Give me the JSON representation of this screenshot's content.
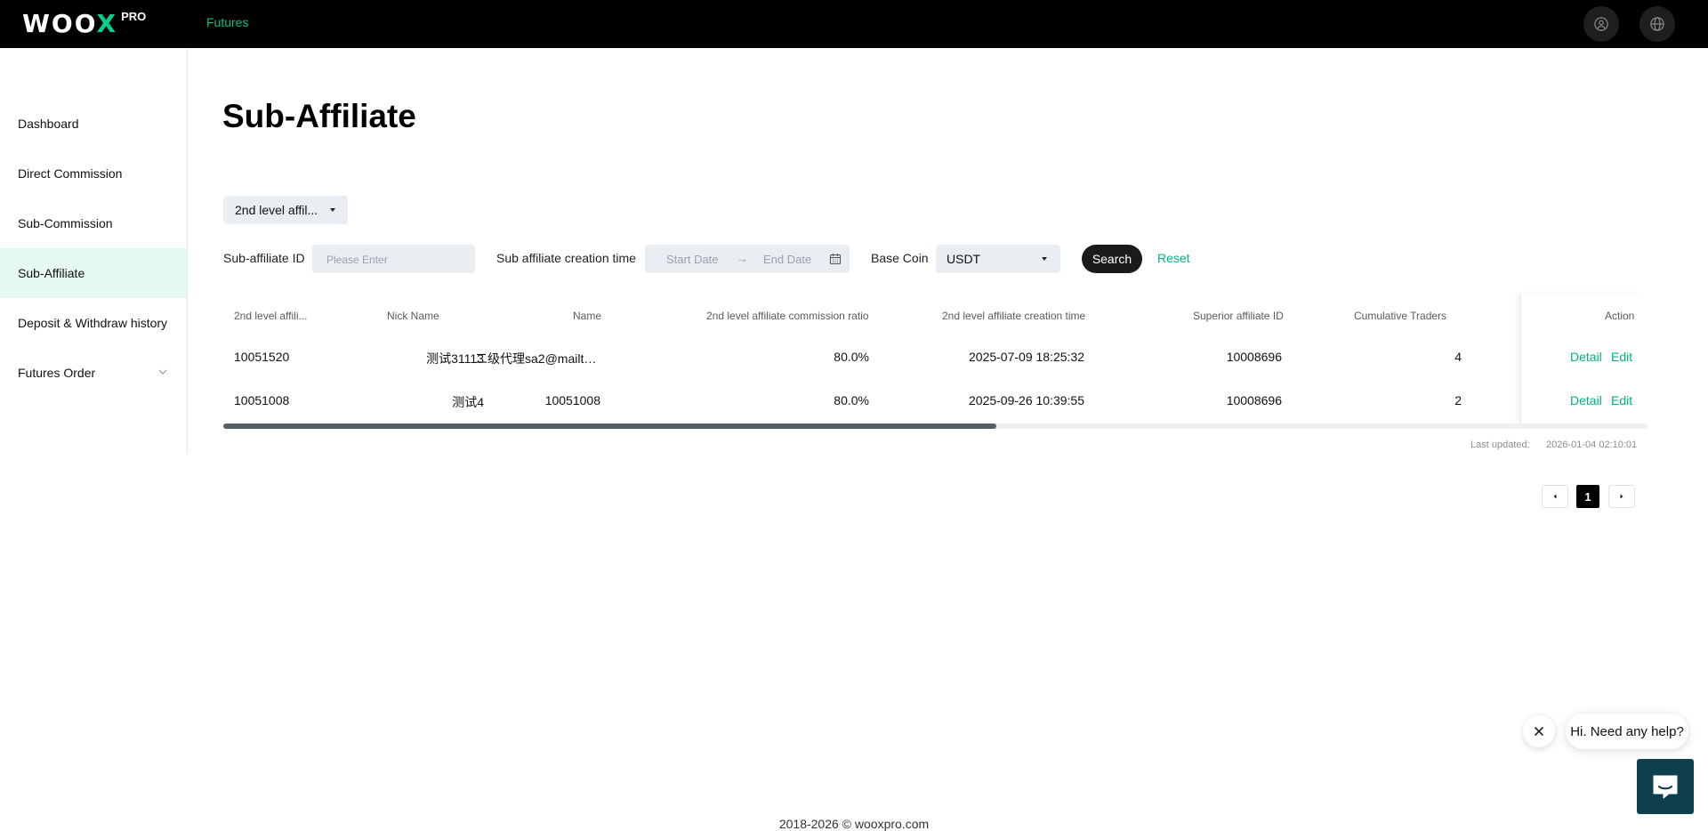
{
  "brand": {
    "logo_main": "WOOX",
    "logo_suffix": "PRO"
  },
  "header": {
    "nav_futures": "Futures",
    "profile_icon": "user-circle-icon",
    "language_icon": "globe-icon"
  },
  "sidebar": {
    "items": [
      {
        "label": "Dashboard"
      },
      {
        "label": "Direct Commission"
      },
      {
        "label": "Sub-Commission"
      },
      {
        "label": "Sub-Affiliate",
        "active": true
      },
      {
        "label": "Deposit & Withdraw history"
      },
      {
        "label": "Futures Order",
        "expandable": true
      }
    ]
  },
  "page": {
    "title": "Sub-Affiliate"
  },
  "level_select": {
    "value": "2nd level affil..."
  },
  "filters": {
    "sub_affiliate_id_label": "Sub-affiliate ID",
    "sub_affiliate_id_placeholder": "Please Enter",
    "creation_time_label": "Sub affiliate creation time",
    "start_date_placeholder": "Start Date",
    "arrow": "→",
    "end_date_placeholder": "End Date",
    "base_coin_label": "Base Coin",
    "base_coin_value": "USDT",
    "search_label": "Search",
    "reset_label": "Reset"
  },
  "table": {
    "headers": {
      "id": "2nd level affili...",
      "nick": "Nick Name",
      "name": "Name",
      "ratio": "2nd level affiliate commission ratio",
      "created": "2nd level affiliate creation time",
      "superior": "Superior affiliate ID",
      "traders": "Cumulative Traders",
      "action": "Action"
    },
    "rows": [
      {
        "id": "10051520",
        "nick": "测试31113",
        "name": "二级代理sa2@mailt…",
        "ratio": "80.0%",
        "created": "2025-07-09 18:25:32",
        "superior": "10008696",
        "traders": "4",
        "detail": "Detail",
        "edit": "Edit"
      },
      {
        "id": "10051008",
        "nick": "测试4",
        "name": "10051008",
        "ratio": "80.0%",
        "created": "2025-09-26 10:39:55",
        "superior": "10008696",
        "traders": "2",
        "detail": "Detail",
        "edit": "Edit"
      }
    ]
  },
  "last_updated": {
    "label": "Last updated:",
    "value": "2026-01-04 02:10:01"
  },
  "pagination": {
    "current": "1"
  },
  "chat": {
    "greeting": "Hi. Need any help?"
  },
  "footer": {
    "text": "2018-2026 © wooxpro.com"
  },
  "colors": {
    "accent": "#00b27a",
    "topbar": "#000000",
    "active_bg": "#e6f8f3"
  }
}
